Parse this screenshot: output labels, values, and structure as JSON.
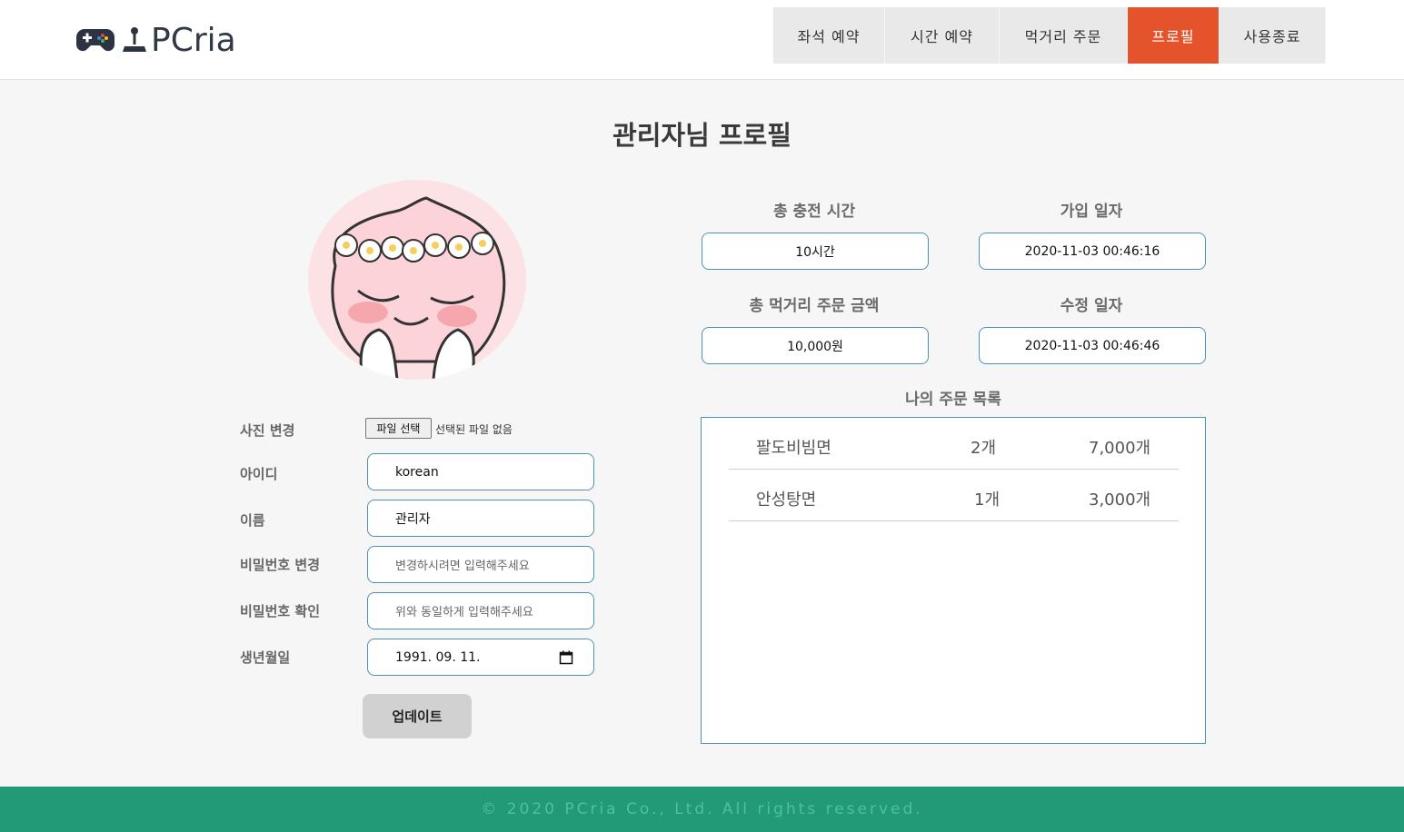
{
  "brand": {
    "name": "PCria",
    "pad_icon": "gamepad-icon",
    "joy_icon": "joystick-icon"
  },
  "nav": [
    {
      "label": "좌석 예약",
      "active": false
    },
    {
      "label": "시간 예약",
      "active": false
    },
    {
      "label": "먹거리 주문",
      "active": false
    },
    {
      "label": "프로필",
      "active": true
    },
    {
      "label": "사용종료",
      "active": false
    }
  ],
  "page_title": "관리자님 프로필",
  "avatar": {
    "description_icon": "profile-avatar"
  },
  "form": {
    "photo_label": "사진 변경",
    "file_button": "파일 선택",
    "file_status": "선택된 파일 없음",
    "id_label": "아이디",
    "id_value": "korean",
    "name_label": "이름",
    "name_value": "관리자",
    "password_label": "비밀번호 변경",
    "password_placeholder": "변경하시려면 입력해주세요",
    "confirm_label": "비밀번호 확인",
    "confirm_placeholder": "위와 동일하게 입력해주세요",
    "birth_label": "생년월일",
    "birth_value": "1991. 09. 11.",
    "update_button": "업데이트"
  },
  "stats": {
    "charge_time_label": "총 충전 시간",
    "charge_time_value": "10시간",
    "join_date_label": "가입 일자",
    "join_date_value": "2020-11-03 00:46:16",
    "food_total_label": "총 먹거리 주문 금액",
    "food_total_value": "10,000원",
    "modified_date_label": "수정 일자",
    "modified_date_value": "2020-11-03 00:46:46"
  },
  "orders": {
    "title": "나의 주문 목록",
    "items": [
      {
        "name": "팔도비빔면",
        "qty": "2개",
        "price": "7,000개"
      },
      {
        "name": "안성탕면",
        "qty": "1개",
        "price": "3,000개"
      }
    ]
  },
  "footer": {
    "text": "© 2020 PCria Co., Ltd. All rights reserved."
  },
  "colors": {
    "accent": "#e4532c",
    "border": "#4b92b7",
    "footer": "#239a77"
  }
}
